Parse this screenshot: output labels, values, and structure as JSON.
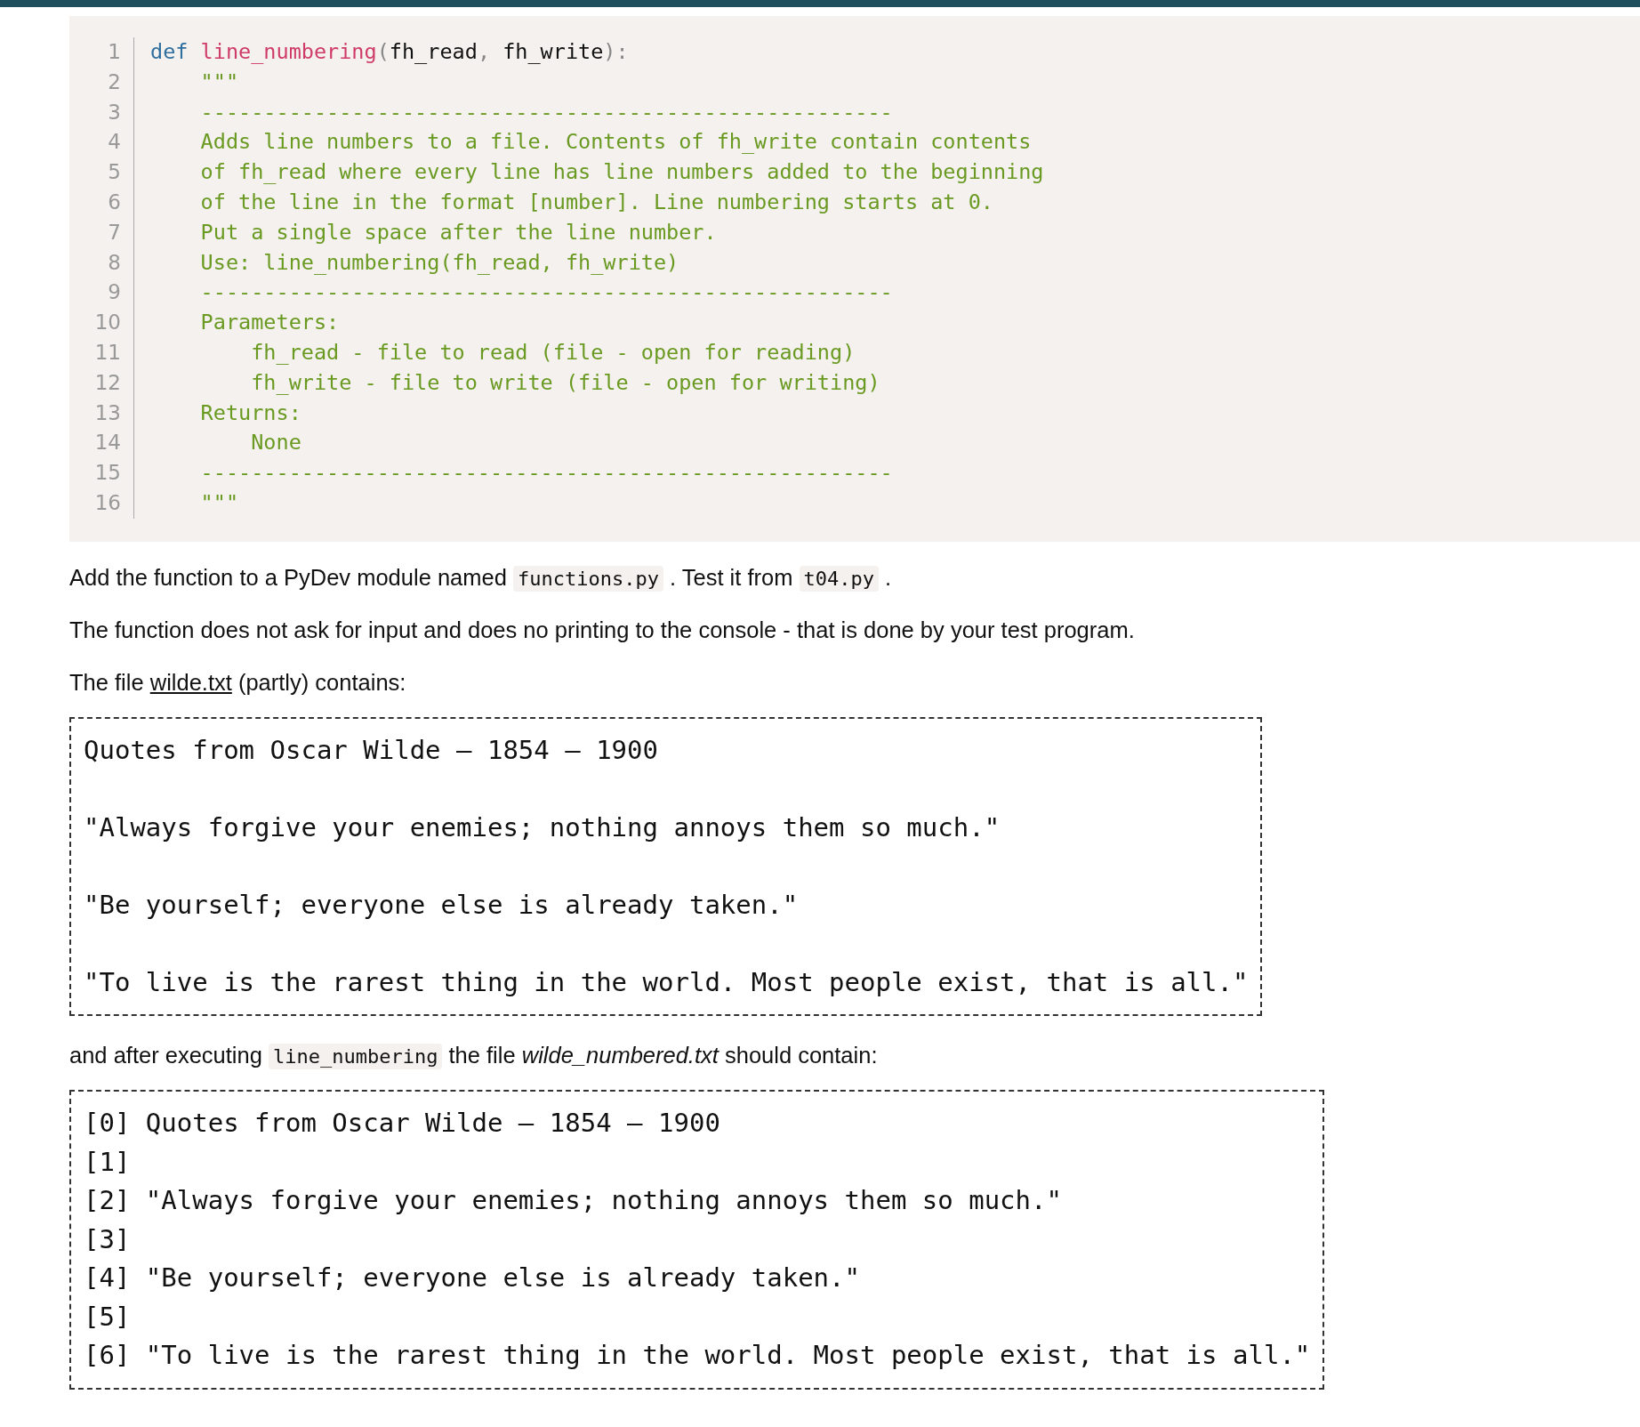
{
  "code_block": {
    "lines": [
      {
        "number": "1",
        "tokens": [
          {
            "text": "def ",
            "kind": "keyword"
          },
          {
            "text": "line_numbering",
            "kind": "function"
          },
          {
            "text": "(",
            "kind": "punct"
          },
          {
            "text": "fh_read",
            "kind": "plain"
          },
          {
            "text": ", ",
            "kind": "punct"
          },
          {
            "text": "fh_write",
            "kind": "plain"
          },
          {
            "text": "):",
            "kind": "punct"
          }
        ]
      },
      {
        "number": "2",
        "tokens": [
          {
            "text": "    \"\"\"",
            "kind": "docstring"
          }
        ]
      },
      {
        "number": "3",
        "tokens": [
          {
            "text": "    -------------------------------------------------------",
            "kind": "docstring"
          }
        ]
      },
      {
        "number": "4",
        "tokens": [
          {
            "text": "    Adds line numbers to a file. Contents of fh_write contain contents",
            "kind": "docstring"
          }
        ]
      },
      {
        "number": "5",
        "tokens": [
          {
            "text": "    of fh_read where every line has line numbers added to the beginning",
            "kind": "docstring"
          }
        ]
      },
      {
        "number": "6",
        "tokens": [
          {
            "text": "    of the line in the format [number]. Line numbering starts at 0.",
            "kind": "docstring"
          }
        ]
      },
      {
        "number": "7",
        "tokens": [
          {
            "text": "    Put a single space after the line number.",
            "kind": "docstring"
          }
        ]
      },
      {
        "number": "8",
        "tokens": [
          {
            "text": "    Use: line_numbering(fh_read, fh_write)",
            "kind": "docstring"
          }
        ]
      },
      {
        "number": "9",
        "tokens": [
          {
            "text": "    -------------------------------------------------------",
            "kind": "docstring"
          }
        ]
      },
      {
        "number": "10",
        "tokens": [
          {
            "text": "    Parameters:",
            "kind": "docstring"
          }
        ]
      },
      {
        "number": "11",
        "tokens": [
          {
            "text": "        fh_read - file to read (file - open for reading)",
            "kind": "docstring"
          }
        ]
      },
      {
        "number": "12",
        "tokens": [
          {
            "text": "        fh_write - file to write (file - open for writing)",
            "kind": "docstring"
          }
        ]
      },
      {
        "number": "13",
        "tokens": [
          {
            "text": "    Returns:",
            "kind": "docstring"
          }
        ]
      },
      {
        "number": "14",
        "tokens": [
          {
            "text": "        None",
            "kind": "docstring"
          }
        ]
      },
      {
        "number": "15",
        "tokens": [
          {
            "text": "    -------------------------------------------------------",
            "kind": "docstring"
          }
        ]
      },
      {
        "number": "16",
        "tokens": [
          {
            "text": "    \"\"\"",
            "kind": "docstring"
          }
        ]
      }
    ]
  },
  "content": [
    {
      "kind": "paragraph",
      "segments": [
        {
          "text": "Add the function to a PyDev module named ",
          "kind": "text"
        },
        {
          "text": "functions.py",
          "kind": "code"
        },
        {
          "text": " . Test it from ",
          "kind": "text"
        },
        {
          "text": "t04.py",
          "kind": "code"
        },
        {
          "text": " .",
          "kind": "text"
        }
      ]
    },
    {
      "kind": "paragraph",
      "segments": [
        {
          "text": "The function does not ask for input and does no printing to the console - that is done by your test program.",
          "kind": "text"
        }
      ]
    },
    {
      "kind": "paragraph",
      "segments": [
        {
          "text": "The file ",
          "kind": "text"
        },
        {
          "text": "wilde.txt",
          "kind": "link"
        },
        {
          "text": " (partly) contains:",
          "kind": "text"
        }
      ]
    },
    {
      "kind": "file_box",
      "spaced": true,
      "lines": [
        "Quotes from Oscar Wilde – 1854 – 1900",
        "\"Always forgive your enemies; nothing annoys them so much.\"",
        "\"Be yourself; everyone else is already taken.\"",
        "\"To live is the rarest thing in the world. Most people exist, that is all.\""
      ]
    },
    {
      "kind": "paragraph",
      "segments": [
        {
          "text": "and after executing ",
          "kind": "text"
        },
        {
          "text": "line_numbering",
          "kind": "code"
        },
        {
          "text": " the file ",
          "kind": "text"
        },
        {
          "text": "wilde_numbered.txt",
          "kind": "italic"
        },
        {
          "text": " should contain:",
          "kind": "text"
        }
      ]
    },
    {
      "kind": "file_box",
      "spaced": false,
      "lines": [
        "[0] Quotes from Oscar Wilde – 1854 – 1900",
        "[1]",
        "[2] \"Always forgive your enemies; nothing annoys them so much.\"",
        "[3]",
        "[4] \"Be yourself; everyone else is already taken.\"",
        "[5]",
        "[6] \"To live is the rarest thing in the world. Most people exist, that is all.\""
      ]
    }
  ]
}
